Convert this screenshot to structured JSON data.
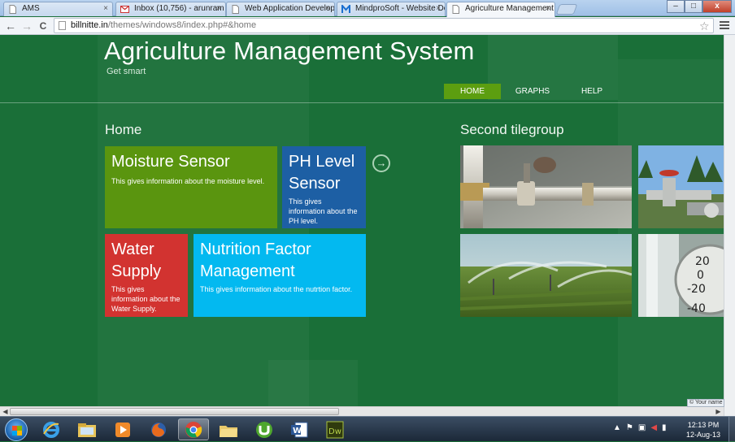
{
  "browser": {
    "tabs": [
      {
        "label": "AMS",
        "icon": "page-icon",
        "active": false
      },
      {
        "label": "Inbox (10,756) - arunram",
        "icon": "gmail-icon",
        "active": false
      },
      {
        "label": "Web Application Develop",
        "icon": "page-icon",
        "active": false
      },
      {
        "label": "MindproSoft - Website De",
        "icon": "mindprosoft-icon",
        "active": false
      },
      {
        "label": "Agriculture Management",
        "icon": "page-icon",
        "active": true
      }
    ],
    "tab_close_glyph": "×",
    "url_host": "billnitte.in",
    "url_path": "/themes/windows8/index.php#&home",
    "back_glyph": "←",
    "forward_glyph": "→",
    "reload_glyph": "C",
    "star_glyph": "☆",
    "window_buttons": {
      "minimize": "–",
      "maximize": "□",
      "close": "x"
    }
  },
  "app": {
    "title": "Agriculture Management System",
    "subtitle": "Get smart",
    "nav": [
      "HOME",
      "GRAPHS",
      "HELP"
    ],
    "active_nav": "HOME",
    "colors": {
      "background": "#1a6f38",
      "nav_active": "#5c9e10"
    }
  },
  "groups": {
    "home": {
      "title": "Home",
      "tiles": [
        {
          "title": "Moisture Sensor",
          "desc": "This gives information about the moisture level.",
          "color": "#5a950f"
        },
        {
          "title": "PH Level Sensor",
          "desc": "This gives information about the PH level.",
          "color": "#1d5fa4"
        },
        {
          "title": "Water Supply",
          "desc": "This gives information about the Water Supply.",
          "color": "#d23330"
        },
        {
          "title": "Nutrition Factor Management",
          "desc": "This gives information about the nutrtion factor.",
          "color": "#03b9f0"
        }
      ],
      "next_arrow": "→"
    },
    "second": {
      "title": "Second tilegroup",
      "photos": [
        "pipe-valve-photo",
        "pipeline-valves-photo",
        "sprinkler-field-photo",
        "thermometer-gauge-photo"
      ]
    }
  },
  "status_popup": "© Your name",
  "taskbar": {
    "apps": [
      "internet-explorer-icon",
      "file-explorer-icon",
      "media-player-icon",
      "firefox-icon",
      "chrome-icon",
      "folder-icon",
      "utorrent-icon",
      "word-icon",
      "dreamweaver-icon"
    ],
    "active_app": "chrome-icon",
    "dreamweaver_label": "Dw",
    "word_label": "W",
    "time": "12:13 PM",
    "date": "12-Aug-13"
  }
}
